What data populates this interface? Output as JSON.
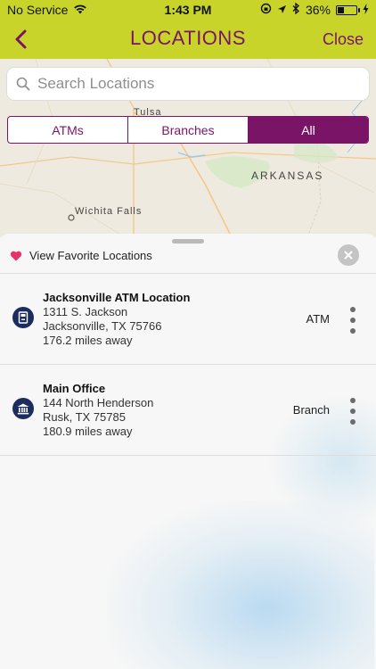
{
  "status_bar": {
    "carrier": "No Service",
    "time": "1:43 PM",
    "battery": "36%",
    "battery_level": 0.36
  },
  "nav": {
    "title": "LOCATIONS",
    "close_label": "Close"
  },
  "map": {
    "labels": {
      "tulsa": "Tulsa",
      "arkansas": "ARKANSAS",
      "wichita_falls": "Wichita Falls"
    }
  },
  "search": {
    "placeholder": "Search Locations",
    "value": ""
  },
  "filter": {
    "segments": [
      "ATMs",
      "Branches",
      "All"
    ],
    "selected": "All"
  },
  "favorites": {
    "label": "View Favorite Locations"
  },
  "locations": [
    {
      "name": "Jacksonville ATM Location",
      "address1": "1311 S. Jackson",
      "address2": "Jacksonville, TX 75766",
      "distance": "176.2 miles away",
      "type": "ATM"
    },
    {
      "name": "Main Office",
      "address1": "144 North Henderson",
      "address2": "Rusk, TX 75785",
      "distance": "180.9 miles away",
      "type": "Branch"
    }
  ],
  "colors": {
    "brand_lime": "#c8d42a",
    "brand_purple": "#7a1466",
    "icon_navy": "#1d2c5e",
    "heart_pink": "#e8306a"
  }
}
